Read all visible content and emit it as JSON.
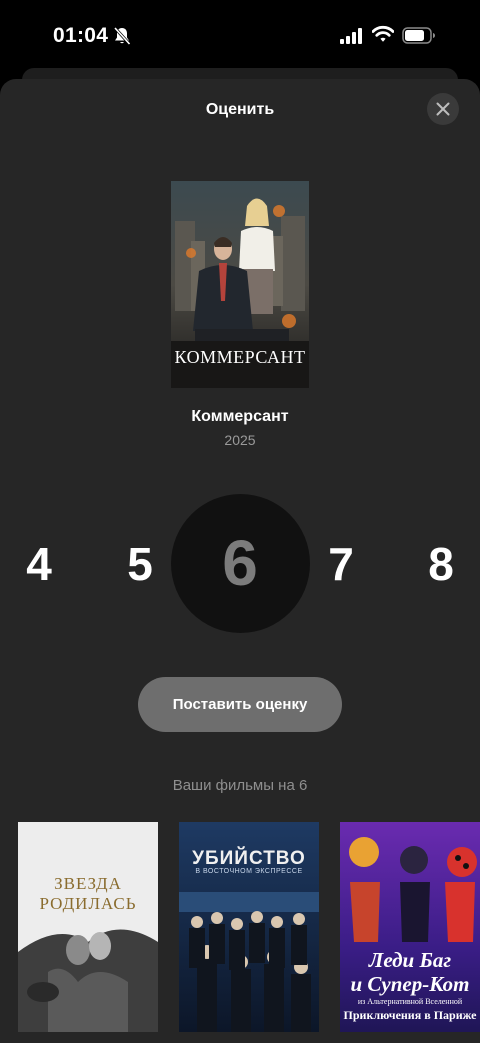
{
  "status_bar": {
    "time": "01:04",
    "icons": [
      "bell-slash-icon",
      "signal-icon",
      "wifi-icon",
      "battery-icon"
    ]
  },
  "sheet": {
    "title": "Оценить",
    "close_icon": "close-icon"
  },
  "movie": {
    "title": "Коммерсант",
    "year": "2025",
    "poster_title": "КОММЕРСАНТ"
  },
  "rating": {
    "options": [
      "4",
      "5",
      "6",
      "7",
      "8"
    ],
    "selected": "6"
  },
  "submit_label": "Поставить оценку",
  "films_heading": "Ваши фильмы на 6",
  "films": [
    {
      "poster_line1": "ЗВЕЗДА",
      "poster_line2": "РОДИЛАСЬ"
    },
    {
      "poster_line1": "УБИЙСТВО",
      "poster_line2": "В ВОСТОЧНОМ ЭКСПРЕССЕ"
    },
    {
      "poster_line1": "Леди Баг",
      "poster_line2": "и Супер-Кот",
      "poster_line3": "из Альтернативной Вселенной",
      "poster_line4": "Приключения в Париже"
    }
  ],
  "colors": {
    "sheet_bg": "#262626",
    "button_bg": "#6e6e6e",
    "selected_circle": "#111111",
    "muted_text": "#8f8f8f"
  }
}
